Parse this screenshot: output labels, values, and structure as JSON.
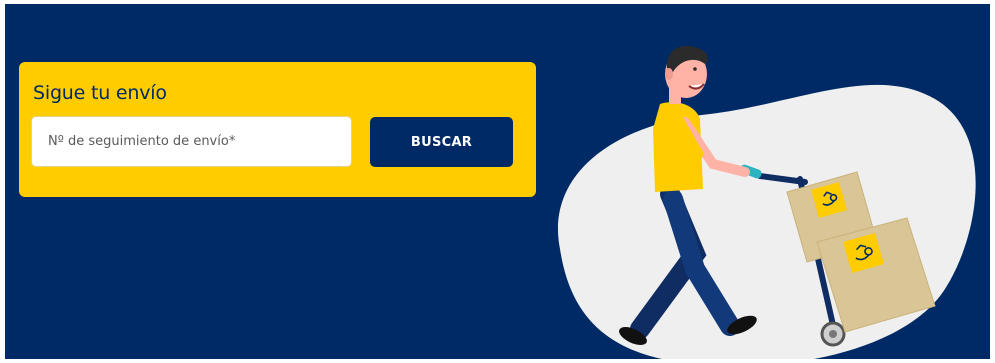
{
  "tracking": {
    "title": "Sigue tu envío",
    "input_placeholder": "Nº de seguimiento de envío*",
    "input_value": "",
    "button_label": "BUSCAR"
  },
  "colors": {
    "banner_background": "#002a66",
    "card_background": "#ffcc00",
    "button_background": "#002a66",
    "button_text": "#ffffff"
  },
  "illustration": {
    "subject": "delivery-person-pushing-hand-truck-with-boxes",
    "icon_names": [
      "correos-horn-logo-icon"
    ]
  }
}
